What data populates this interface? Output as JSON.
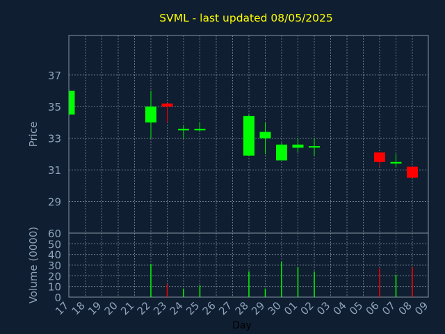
{
  "chart_data": {
    "type": "candlestick",
    "title": "SVML - last updated 08/05/2025",
    "xlabel": "Day",
    "price_panel": {
      "ylabel": "Price",
      "ylim": [
        27,
        39.5
      ],
      "yticks": [
        29,
        31,
        33,
        35,
        37
      ]
    },
    "volume_panel": {
      "ylabel": "Volume (0000)",
      "ylim": [
        0,
        60
      ],
      "yticks": [
        0,
        10,
        20,
        30,
        40,
        50,
        60
      ]
    },
    "categories": [
      "17",
      "18",
      "19",
      "20",
      "21",
      "22",
      "23",
      "24",
      "25",
      "26",
      "27",
      "28",
      "29",
      "30",
      "01",
      "02",
      "03",
      "04",
      "05",
      "06",
      "07",
      "08",
      "09"
    ],
    "candles": [
      {
        "day": "17",
        "open": 34.5,
        "high": 36.0,
        "low": 34.5,
        "close": 36.0,
        "volume": 0
      },
      {
        "day": "22",
        "open": 34.0,
        "high": 36.0,
        "low": 33.0,
        "close": 35.0,
        "volume": 31
      },
      {
        "day": "23",
        "open": 35.2,
        "high": 35.2,
        "low": 34.0,
        "close": 35.0,
        "volume": 12
      },
      {
        "day": "24",
        "open": 33.5,
        "high": 33.8,
        "low": 33.0,
        "close": 33.6,
        "volume": 8
      },
      {
        "day": "25",
        "open": 33.5,
        "high": 34.0,
        "low": 33.4,
        "close": 33.6,
        "volume": 11
      },
      {
        "day": "28",
        "open": 31.9,
        "high": 34.5,
        "low": 31.9,
        "close": 34.4,
        "volume": 24
      },
      {
        "day": "29",
        "open": 33.0,
        "high": 34.0,
        "low": 32.0,
        "close": 33.4,
        "volume": 8
      },
      {
        "day": "30",
        "open": 31.6,
        "high": 32.7,
        "low": 31.6,
        "close": 32.6,
        "volume": 33
      },
      {
        "day": "01",
        "open": 32.4,
        "high": 33.0,
        "low": 32.1,
        "close": 32.6,
        "volume": 28
      },
      {
        "day": "02",
        "open": 32.5,
        "high": 33.0,
        "low": 31.9,
        "close": 32.5,
        "volume": 24
      },
      {
        "day": "06",
        "open": 32.1,
        "high": 32.1,
        "low": 31.2,
        "close": 31.5,
        "volume": 27
      },
      {
        "day": "07",
        "open": 31.4,
        "high": 32.0,
        "low": 31.2,
        "close": 31.5,
        "volume": 21
      },
      {
        "day": "08",
        "open": 31.2,
        "high": 31.2,
        "low": 30.6,
        "close": 30.5,
        "volume": 28
      }
    ],
    "grid": true
  },
  "colors": {
    "background": "#0f1e30",
    "grid": "#7f8d9c",
    "axis": "#8796a6",
    "up": "#00ff00",
    "down": "#ff0000",
    "title": "#ffff00",
    "label": "#8ea4bc",
    "tick": "#8ea4bc",
    "xlabel": "#000000"
  }
}
